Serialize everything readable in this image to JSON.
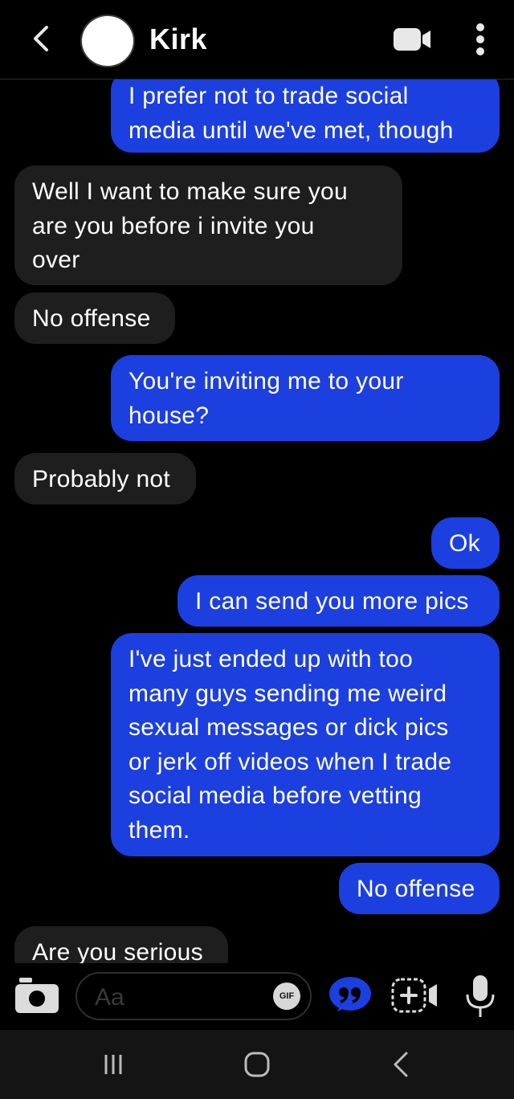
{
  "header": {
    "contact_name": "Kirk",
    "back_icon": "chevron-left-icon",
    "video_icon": "video-camera-icon",
    "more_icon": "more-vertical-icon"
  },
  "messages": [
    {
      "from": "me",
      "text": "I prefer not to trade social\nmedia until we've met, though"
    },
    {
      "from": "them",
      "text": "Well I want to make sure you\nare you before i invite you\nover"
    },
    {
      "from": "them",
      "text": "No offense"
    },
    {
      "from": "me",
      "text": "You're inviting me to your\nhouse?"
    },
    {
      "from": "them",
      "text": "Probably not"
    },
    {
      "from": "me",
      "text": "Ok"
    },
    {
      "from": "me",
      "text": "I can send you more pics"
    },
    {
      "from": "me",
      "text": "I've just ended up with too\nmany guys sending me weird\nsexual messages or dick pics\nor jerk off videos when I trade\nsocial media before vetting\nthem."
    },
    {
      "from": "me",
      "text": "No offense"
    },
    {
      "from": "them",
      "text": "Are you serious"
    }
  ],
  "composer": {
    "placeholder": "Aa",
    "gif_label": "GIF"
  },
  "colors": {
    "outgoing_bubble": "#1c3fe0",
    "incoming_bubble": "#1e1e1e",
    "background": "#000000"
  }
}
